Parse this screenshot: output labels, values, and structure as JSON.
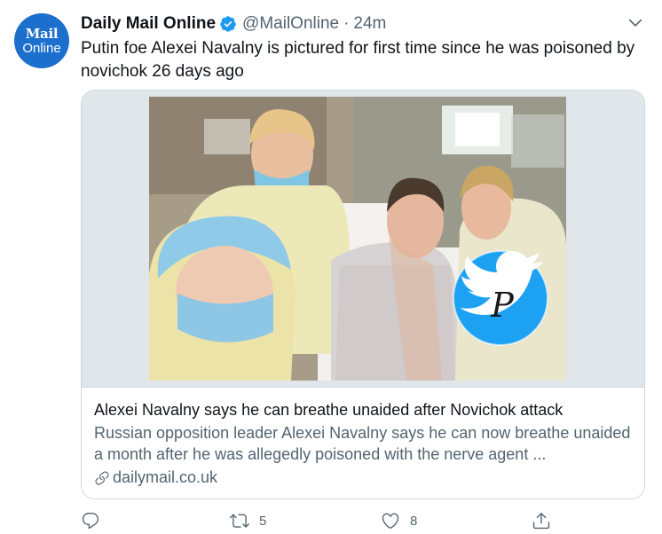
{
  "account": {
    "display_name": "Daily Mail Online",
    "handle": "@MailOnline",
    "separator": "·",
    "timestamp": "24m",
    "verified": true,
    "avatar_logo_top": "Mail",
    "avatar_logo_bottom": "Online",
    "avatar_color": "#1d6fce"
  },
  "tweet": {
    "text": "Putin foe Alexei Navalny is pictured for first time since he was poisoned by novichok 26 days ago"
  },
  "card": {
    "title": "Alexei Navalny says he can breathe unaided after Novichok attack",
    "description": "Russian opposition leader Alexei Navalny says he can now breathe unaided a month after he was allegedly poisoned with the nerve agent ...",
    "domain": "dailymail.co.uk",
    "image_watermark_letter": "P"
  },
  "actions": {
    "reply_count": "",
    "retweet_count": "5",
    "like_count": "8"
  },
  "icons": {
    "verified": "verified-badge-icon",
    "caret": "chevron-down-icon",
    "reply": "reply-icon",
    "retweet": "retweet-icon",
    "like": "heart-icon",
    "share": "share-icon",
    "link": "link-icon"
  },
  "colors": {
    "accent_blue": "#1d9bf0",
    "secondary_text": "#536471",
    "primary_text": "#0f1419",
    "border": "#cfd9de"
  }
}
